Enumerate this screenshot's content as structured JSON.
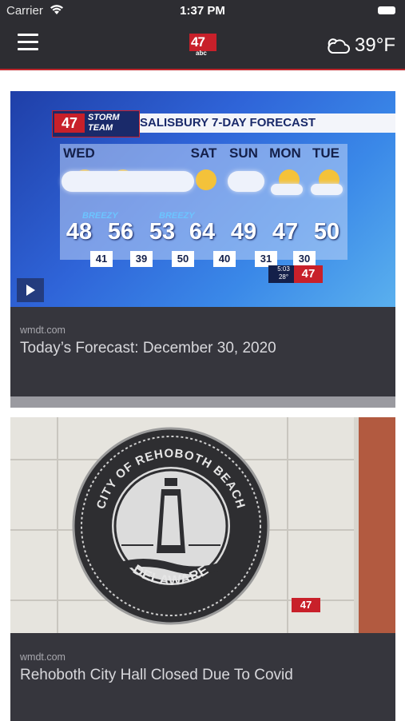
{
  "status_bar": {
    "carrier": "Carrier",
    "time": "1:37 PM",
    "wifi_icon": "wifi-icon",
    "battery_icon": "battery-icon"
  },
  "nav": {
    "menu_icon": "hamburger-menu-icon",
    "logo_text": "47",
    "logo_subtext": "abc",
    "weather_icon": "cloud-icon",
    "temperature": "39°F",
    "accent_color": "#c0282d"
  },
  "feed": [
    {
      "source": "wmdt.com",
      "title": "Today’s Forecast: December 30, 2020",
      "has_video": true,
      "image": {
        "brand_badge": "47",
        "brand_text_line1": "STORM",
        "brand_text_line2": "TEAM",
        "header": "SALISBURY 7-DAY FORECAST",
        "days": [
          "WED",
          "SAT",
          "SUN",
          "MON",
          "TUE"
        ],
        "breezy": [
          "BREEZY",
          "BREEZY"
        ],
        "highs": [
          "48",
          "56",
          "53",
          "64",
          "49",
          "47",
          "50"
        ],
        "lows": [
          "41",
          "39",
          "50",
          "40",
          "31",
          "30"
        ],
        "clock": "5:03",
        "clock_temp": "28°",
        "corner_badge": "47"
      }
    },
    {
      "source": "wmdt.com",
      "title": "Rehoboth City Hall Closed Due To Covid",
      "has_video": false,
      "image": {
        "seal_top_text": "CITY OF REHOBOTH BEACH",
        "seal_bottom_text": "DELAWARE",
        "corner_badge": "47"
      }
    }
  ]
}
